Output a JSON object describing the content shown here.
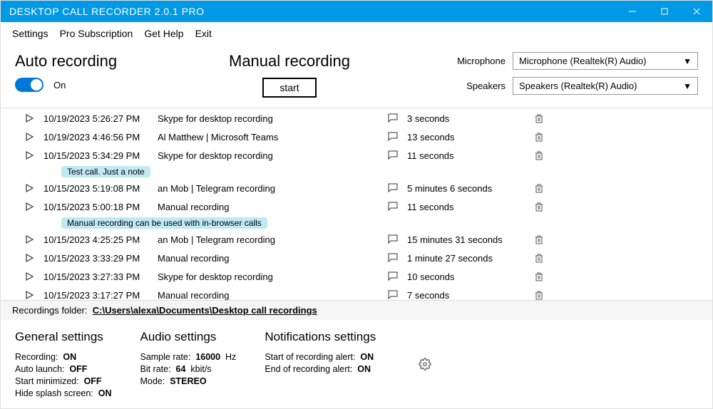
{
  "titlebar": {
    "title": "DESKTOP CALL RECORDER 2.0.1 PRO"
  },
  "menu": {
    "settings": "Settings",
    "pro": "Pro Subscription",
    "help": "Get Help",
    "exit": "Exit"
  },
  "auto": {
    "title": "Auto recording",
    "state": "On"
  },
  "manual": {
    "title": "Manual recording",
    "button": "start"
  },
  "devices": {
    "mic_label": "Microphone",
    "mic_value": "Microphone (Realtek(R) Audio)",
    "spk_label": "Speakers",
    "spk_value": "Speakers (Realtek(R) Audio)"
  },
  "recordings": [
    {
      "time": "10/19/2023 5:26:27 PM",
      "source": "Skype for desktop recording",
      "duration": "3 seconds",
      "note": null
    },
    {
      "time": "10/19/2023 4:46:56 PM",
      "source": "Al Matthew | Microsoft Teams",
      "duration": "13 seconds",
      "note": null
    },
    {
      "time": "10/15/2023 5:34:29 PM",
      "source": "Skype for desktop recording",
      "duration": "11 seconds",
      "note": "Test call. Just a note"
    },
    {
      "time": "10/15/2023 5:19:08 PM",
      "source": "an Mob | Telegram recording",
      "duration": "5 minutes 6 seconds",
      "note": null
    },
    {
      "time": "10/15/2023 5:00:18 PM",
      "source": "Manual recording",
      "duration": "11 seconds",
      "note": "Manual recording can be used with in-browser calls"
    },
    {
      "time": "10/15/2023 4:25:25 PM",
      "source": "an Mob | Telegram recording",
      "duration": "15 minutes 31 seconds",
      "note": null
    },
    {
      "time": "10/15/2023 3:33:29 PM",
      "source": "Manual recording",
      "duration": "1 minute 27 seconds",
      "note": null
    },
    {
      "time": "10/15/2023 3:27:33 PM",
      "source": "Skype for desktop recording",
      "duration": "10 seconds",
      "note": null
    },
    {
      "time": "10/15/2023 3:17:27 PM",
      "source": "Manual recording",
      "duration": "7 seconds",
      "note": null
    }
  ],
  "folder": {
    "label": "Recordings folder:",
    "path": "C:\\Users\\alexa\\Documents\\Desktop call recordings"
  },
  "settings": {
    "general": {
      "title": "General settings",
      "items": [
        {
          "key": "Recording:",
          "val": "ON"
        },
        {
          "key": "Auto launch:",
          "val": "OFF"
        },
        {
          "key": "Start minimized:",
          "val": "OFF"
        },
        {
          "key": "Hide splash screen:",
          "val": "ON"
        }
      ]
    },
    "audio": {
      "title": "Audio settings",
      "items": [
        {
          "key": "Sample rate:",
          "val": "16000",
          "unit": "Hz"
        },
        {
          "key": "Bit rate:",
          "val": "64",
          "unit": "kbit/s"
        },
        {
          "key": "Mode:",
          "val": "STEREO",
          "unit": ""
        }
      ]
    },
    "notifications": {
      "title": "Notifications settings",
      "items": [
        {
          "key": "Start of recording alert:",
          "val": "ON"
        },
        {
          "key": "End of recording alert:",
          "val": "ON"
        }
      ]
    }
  }
}
